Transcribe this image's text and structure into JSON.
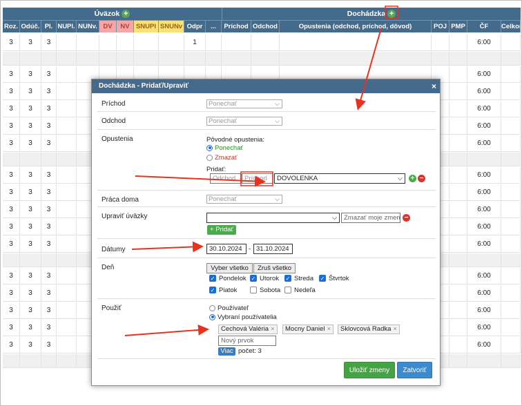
{
  "table": {
    "group_uvazok": "Úväzok",
    "group_dochadzka": "Dochádzka",
    "columns": [
      {
        "label": "Roz.",
        "bg": ""
      },
      {
        "label": "Odúč.",
        "bg": ""
      },
      {
        "label": "Pl.",
        "bg": ""
      },
      {
        "label": "NUPl.",
        "bg": ""
      },
      {
        "label": "NUNv.",
        "bg": ""
      },
      {
        "label": "DV",
        "bg": "#f2a8a8"
      },
      {
        "label": "NV",
        "bg": "#f2a8a8"
      },
      {
        "label": "SNUPl",
        "bg": "#f7e27a"
      },
      {
        "label": "SNUNv",
        "bg": "#f7e27a"
      },
      {
        "label": "Odpr",
        "bg": ""
      },
      {
        "label": "...",
        "bg": ""
      },
      {
        "label": "Príchod",
        "bg": ""
      },
      {
        "label": "Odchod",
        "bg": ""
      },
      {
        "label": "Opustenia (odchod, príchod, dôvod)",
        "bg": ""
      },
      {
        "label": "POJ",
        "bg": ""
      },
      {
        "label": "PMP",
        "bg": ""
      },
      {
        "label": "ČF",
        "bg": ""
      },
      {
        "label": "Celkom",
        "bg": ""
      }
    ],
    "rows": [
      {
        "roz": "3",
        "oduc": "3",
        "pl": "3",
        "odpr": "1",
        "cf": "6:00",
        "gray": false
      },
      {
        "roz": "",
        "oduc": "",
        "pl": "",
        "odpr": "",
        "cf": "",
        "gray": true
      },
      {
        "roz": "3",
        "oduc": "3",
        "pl": "3",
        "odpr": "",
        "cf": "6:00",
        "gray": false
      },
      {
        "roz": "3",
        "oduc": "3",
        "pl": "3",
        "odpr": "",
        "cf": "6:00",
        "gray": false
      },
      {
        "roz": "3",
        "oduc": "3",
        "pl": "3",
        "odpr": "",
        "cf": "6:00",
        "gray": false
      },
      {
        "roz": "3",
        "oduc": "3",
        "pl": "3",
        "odpr": "",
        "cf": "6:00",
        "gray": false
      },
      {
        "roz": "3",
        "oduc": "3",
        "pl": "3",
        "odpr": "",
        "cf": "6:00",
        "gray": false
      },
      {
        "roz": "",
        "oduc": "",
        "pl": "",
        "odpr": "",
        "cf": "",
        "gray": true
      },
      {
        "roz": "3",
        "oduc": "3",
        "pl": "3",
        "odpr": "",
        "cf": "6:00",
        "gray": false
      },
      {
        "roz": "3",
        "oduc": "3",
        "pl": "3",
        "odpr": "",
        "cf": "6:00",
        "gray": false
      },
      {
        "roz": "3",
        "oduc": "3",
        "pl": "3",
        "odpr": "",
        "cf": "6:00",
        "gray": false
      },
      {
        "roz": "3",
        "oduc": "3",
        "pl": "3",
        "odpr": "",
        "cf": "6:00",
        "gray": false
      },
      {
        "roz": "3",
        "oduc": "3",
        "pl": "3",
        "odpr": "",
        "cf": "6:00",
        "gray": false
      },
      {
        "roz": "",
        "oduc": "",
        "pl": "",
        "odpr": "",
        "cf": "",
        "gray": true
      },
      {
        "roz": "3",
        "oduc": "3",
        "pl": "3",
        "odpr": "",
        "cf": "6:00",
        "gray": false
      },
      {
        "roz": "3",
        "oduc": "3",
        "pl": "3",
        "odpr": "",
        "cf": "6:00",
        "gray": false
      },
      {
        "roz": "3",
        "oduc": "3",
        "pl": "3",
        "odpr": "",
        "cf": "6:00",
        "gray": false
      },
      {
        "roz": "3",
        "oduc": "3",
        "pl": "3",
        "odpr": "",
        "cf": "6:00",
        "gray": false
      },
      {
        "roz": "3",
        "oduc": "3",
        "pl": "3",
        "odpr": "",
        "cf": "6:00",
        "gray": false
      },
      {
        "roz": "",
        "oduc": "",
        "pl": "",
        "odpr": "",
        "cf": "",
        "gray": true
      }
    ]
  },
  "modal": {
    "title": "Dochádzka - Pridať/Upraviť",
    "close": "×",
    "prichod_label": "Príchod",
    "prichod_value": "Ponechať",
    "odchod_label": "Odchod",
    "odchod_value": "Ponechať",
    "opustenia_label": "Opustenia",
    "povodne": "Pôvodné opustenia:",
    "ponechat": "Ponechať",
    "zmazat": "Zmazať",
    "pridat": "Pridať:",
    "odchod_ph": "Odchod",
    "prichod_ph": "Príchod",
    "dovod_value": "DOVOLENKA",
    "praca_doma_label": "Práca doma",
    "praca_doma_value": "Ponechať",
    "upravit_label": "Upraviť úväzky",
    "upravit_select": "",
    "zmazat_zmeny_ph": "Zmazať moje zmeny",
    "pridat_btn": "+ Pridať",
    "datumy_label": "Dátumy",
    "date_from": "30.10.2024",
    "date_sep": "-",
    "date_to": "31.10.2024",
    "den_label": "Deň",
    "vyber_vsetko": "Vyber všetko",
    "zrus_vsetko": "Zruš všetko",
    "days": {
      "pondelok": "Pondelok",
      "utorok": "Utorok",
      "streda": "Streda",
      "stvrtok": "Štvrtok",
      "piatok": "Piatok",
      "sobota": "Sobota",
      "nedela": "Nedeľa"
    },
    "pouzit_label": "Použiť",
    "pouzivatel": "Používateľ",
    "vybrani": "Vybraní používatelia",
    "tags": [
      "Cechová Valéria",
      "Mocny Daniel",
      "Sklovcová Radka"
    ],
    "novy_prvok": "Nový prvok",
    "viac": "Viac",
    "pocet": "počet: 3",
    "ulozit": "Uložiť zmeny",
    "zatvorit": "Zatvoriť"
  },
  "colors": {
    "header": "#456b8c",
    "green": "#4caa4c",
    "blue_btn": "#3a8bd0",
    "red_arrow": "#e8321e"
  }
}
